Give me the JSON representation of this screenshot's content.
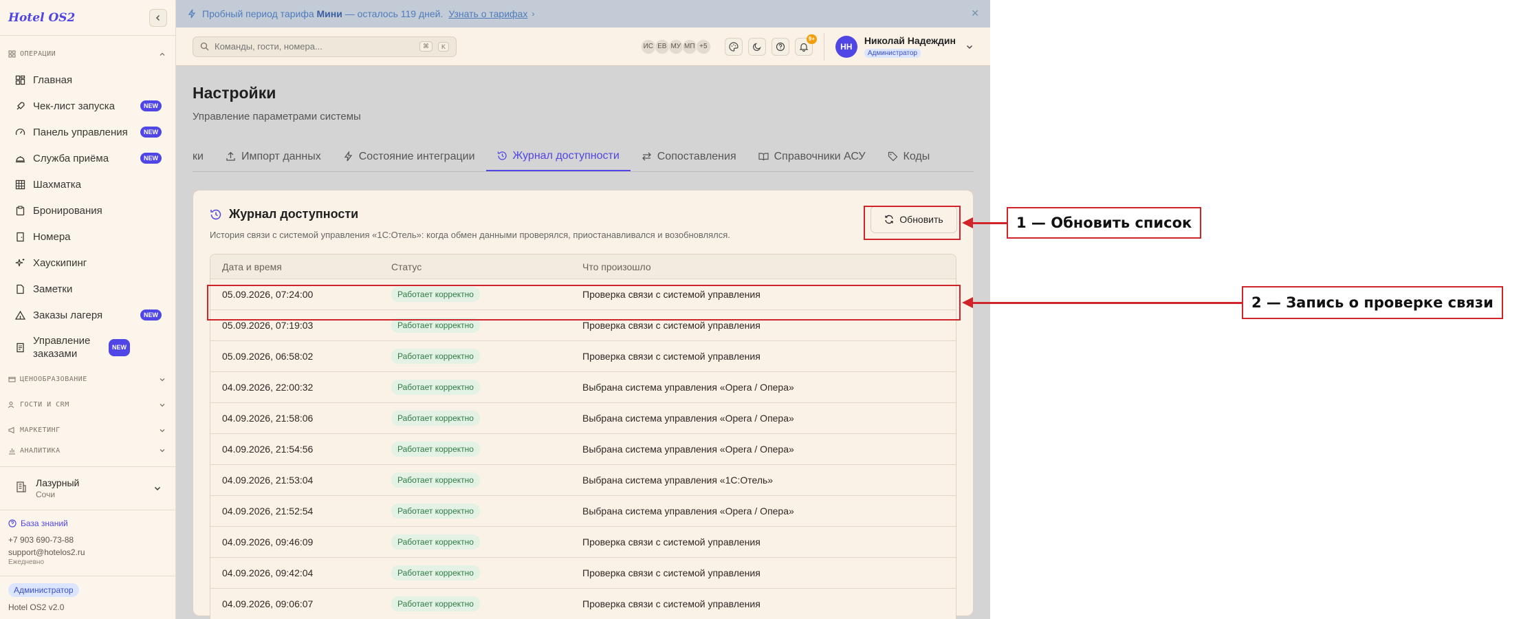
{
  "app": {
    "logo": "Hotel OS2"
  },
  "sidebar": {
    "operations_section": "ОПЕРАЦИИ",
    "items": [
      {
        "label": "Главная",
        "badge": ""
      },
      {
        "label": "Чек-лист запуска",
        "badge": "NEW"
      },
      {
        "label": "Панель управления",
        "badge": "NEW"
      },
      {
        "label": "Служба приёма",
        "badge": "NEW"
      },
      {
        "label": "Шахматка",
        "badge": ""
      },
      {
        "label": "Бронирования",
        "badge": ""
      },
      {
        "label": "Номера",
        "badge": ""
      },
      {
        "label": "Хаускипинг",
        "badge": ""
      },
      {
        "label": "Заметки",
        "badge": ""
      },
      {
        "label": "Заказы лагеря",
        "badge": "NEW"
      },
      {
        "label": "Управление заказами",
        "badge": "NEW"
      }
    ],
    "sections": [
      "ЦЕНООБРАЗОВАНИЕ",
      "ГОСТИ И CRM",
      "МАРКЕТИНГ",
      "АНАЛИТИКА"
    ],
    "hotel": {
      "name": "Лазурный",
      "city": "Сочи"
    },
    "support": {
      "kb_link": "База знаний",
      "phone": "+7 903 690-73-88",
      "email": "support@hotelos2.ru",
      "schedule": "Ежедневно"
    },
    "role": "Администратор",
    "version": "Hotel OS2 v2.0"
  },
  "banner": {
    "prefix": "Пробный период тарифа",
    "plan": "Мини",
    "suffix": "— осталось 119 дней.",
    "link": "Узнать о тарифах"
  },
  "topbar": {
    "search_placeholder": "Команды, гости, номера...",
    "shortcut_1": "⌘",
    "shortcut_2": "K",
    "avatars": [
      "ИС",
      "ЕВ",
      "МУ",
      "МП",
      "+5"
    ],
    "notif_count": "9+",
    "user": {
      "initials": "НН",
      "name": "Николай Надеждин",
      "role": "Администратор"
    }
  },
  "page": {
    "title": "Настройки",
    "subtitle": "Управление параметрами системы",
    "tabs": [
      {
        "label": "ки"
      },
      {
        "label": "Импорт данных"
      },
      {
        "label": "Состояние интеграции"
      },
      {
        "label": "Журнал доступности"
      },
      {
        "label": "Сопоставления"
      },
      {
        "label": "Справочники АСУ"
      },
      {
        "label": "Коды"
      }
    ]
  },
  "card": {
    "title": "Журнал доступности",
    "description": "История связи с системой управления «1С:Отель»: когда обмен данными проверялся, приостанавливался и возобновлялся.",
    "refresh_label": "Обновить",
    "columns": [
      "Дата и время",
      "Статус",
      "Что произошло"
    ],
    "rows": [
      {
        "datetime": "05.09.2026, 07:24:00",
        "status": "Работает корректно",
        "event": "Проверка связи с системой управления"
      },
      {
        "datetime": "05.09.2026, 07:19:03",
        "status": "Работает корректно",
        "event": "Проверка связи с системой управления"
      },
      {
        "datetime": "05.09.2026, 06:58:02",
        "status": "Работает корректно",
        "event": "Проверка связи с системой управления"
      },
      {
        "datetime": "04.09.2026, 22:00:32",
        "status": "Работает корректно",
        "event": "Выбрана система управления «Opera / Опера»"
      },
      {
        "datetime": "04.09.2026, 21:58:06",
        "status": "Работает корректно",
        "event": "Выбрана система управления «Opera / Опера»"
      },
      {
        "datetime": "04.09.2026, 21:54:56",
        "status": "Работает корректно",
        "event": "Выбрана система управления «Opera / Опера»"
      },
      {
        "datetime": "04.09.2026, 21:53:04",
        "status": "Работает корректно",
        "event": "Выбрана система управления «1С:Отель»"
      },
      {
        "datetime": "04.09.2026, 21:52:54",
        "status": "Работает корректно",
        "event": "Выбрана система управления «Opera / Опера»"
      },
      {
        "datetime": "04.09.2026, 09:46:09",
        "status": "Работает корректно",
        "event": "Проверка связи с системой управления"
      },
      {
        "datetime": "04.09.2026, 09:42:04",
        "status": "Работает корректно",
        "event": "Проверка связи с системой управления"
      },
      {
        "datetime": "04.09.2026, 09:06:07",
        "status": "Работает корректно",
        "event": "Проверка связи с системой управления"
      }
    ]
  },
  "annotations": {
    "callout_1": "1 — Обновить список",
    "callout_2": "2 — Запись о проверке связи"
  }
}
